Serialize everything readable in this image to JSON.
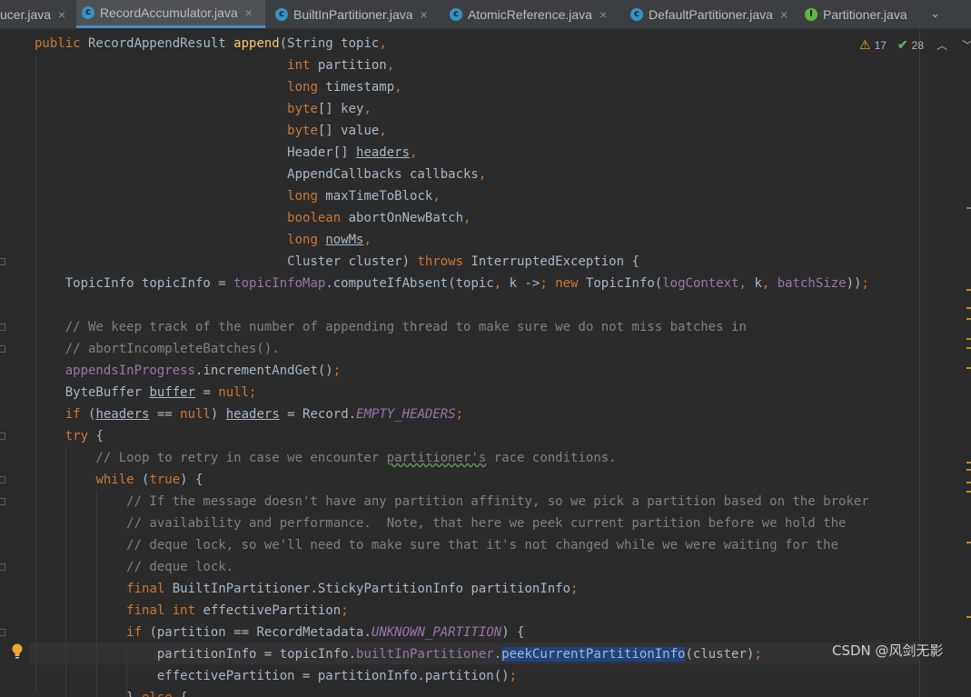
{
  "tabs": [
    {
      "label": "ucer.java",
      "icon": "class-icon",
      "active": false
    },
    {
      "label": "RecordAccumulator.java",
      "icon": "class-icon",
      "active": true
    },
    {
      "label": "BuiltInPartitioner.java",
      "icon": "class-icon",
      "active": false
    },
    {
      "label": "AtomicReference.java",
      "icon": "class-icon-locked",
      "active": false
    },
    {
      "label": "DefaultPartitioner.java",
      "icon": "class-icon",
      "active": false
    },
    {
      "label": "Partitioner.java",
      "icon": "interface-icon",
      "active": false
    }
  ],
  "tab_close_glyph": "×",
  "tab_overflow_glyph": "⌄",
  "inspections": {
    "warnings": "17",
    "ok": "28"
  },
  "watermark": "CSDN @风剑无影",
  "colors": {
    "background": "#2b2b2b",
    "keyword": "#cc7832",
    "text": "#a9b7c6",
    "field": "#9876aa",
    "method_decl": "#ffc66d",
    "comment": "#808080",
    "selection": "#214283",
    "accent": "#4a88c7"
  },
  "code_lines": [
    "public RecordAppendResult append(String topic,",
    "                                 int partition,",
    "                                 long timestamp,",
    "                                 byte[] key,",
    "                                 byte[] value,",
    "                                 Header[] headers,",
    "                                 AppendCallbacks callbacks,",
    "                                 long maxTimeToBlock,",
    "                                 boolean abortOnNewBatch,",
    "                                 long nowMs,",
    "                                 Cluster cluster) throws InterruptedException {",
    "    TopicInfo topicInfo = topicInfoMap.computeIfAbsent(topic, k -> new TopicInfo(logContext, k, batchSize));",
    "",
    "    // We keep track of the number of appending thread to make sure we do not miss batches in",
    "    // abortIncompleteBatches().",
    "    appendsInProgress.incrementAndGet();",
    "    ByteBuffer buffer = null;",
    "    if (headers == null) headers = Record.EMPTY_HEADERS;",
    "    try {",
    "        // Loop to retry in case we encounter partitioner's race conditions.",
    "        while (true) {",
    "            // If the message doesn't have any partition affinity, so we pick a partition based on the broker",
    "            // availability and performance.  Note, that here we peek current partition before we hold the",
    "            // deque lock, so we'll need to make sure that it's not changed while we were waiting for the",
    "            // deque lock.",
    "            final BuiltInPartitioner.StickyPartitionInfo partitionInfo;",
    "            final int effectivePartition;",
    "            if (partition == RecordMetadata.UNKNOWN_PARTITION) {",
    "                partitionInfo = topicInfo.builtInPartitioner.peekCurrentPartitionInfo(cluster);",
    "                effectivePartition = partitionInfo.partition();",
    "            } else {"
  ]
}
